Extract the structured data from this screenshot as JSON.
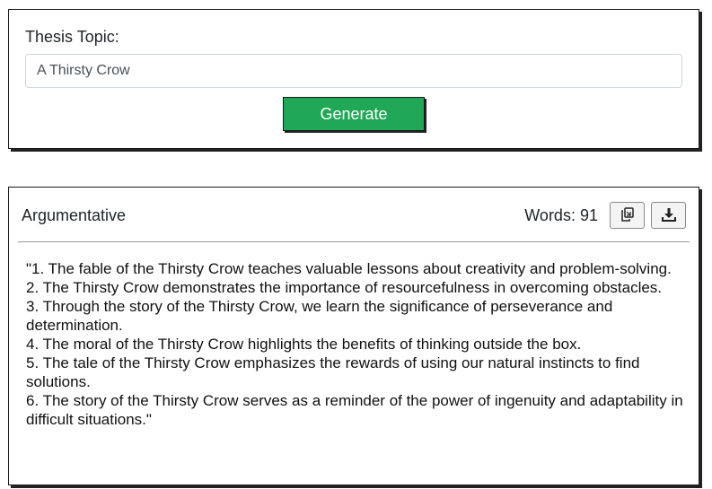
{
  "topic_form": {
    "label": "Thesis Topic:",
    "input_value": "A Thirsty Crow",
    "generate_label": "Generate"
  },
  "result": {
    "type_label": "Argumentative",
    "word_count_label": "Words:",
    "word_count": "91",
    "copy_icon": "copy-icon",
    "download_icon": "download-icon",
    "text": "\"1. The fable of the Thirsty Crow teaches valuable lessons about creativity and problem-solving.\n2. The Thirsty Crow demonstrates the importance of resourcefulness in overcoming obstacles.\n3. Through the story of the Thirsty Crow, we learn the significance of perseverance and determination.\n4. The moral of the Thirsty Crow highlights the benefits of thinking outside the box.\n5. The tale of the Thirsty Crow emphasizes the rewards of using our natural instincts to find solutions.\n6. The story of the Thirsty Crow serves as a reminder of the power of ingenuity and adaptability in difficult situations.\""
  },
  "colors": {
    "generate_button": "#21a857",
    "card_border": "#1a1a1a"
  }
}
